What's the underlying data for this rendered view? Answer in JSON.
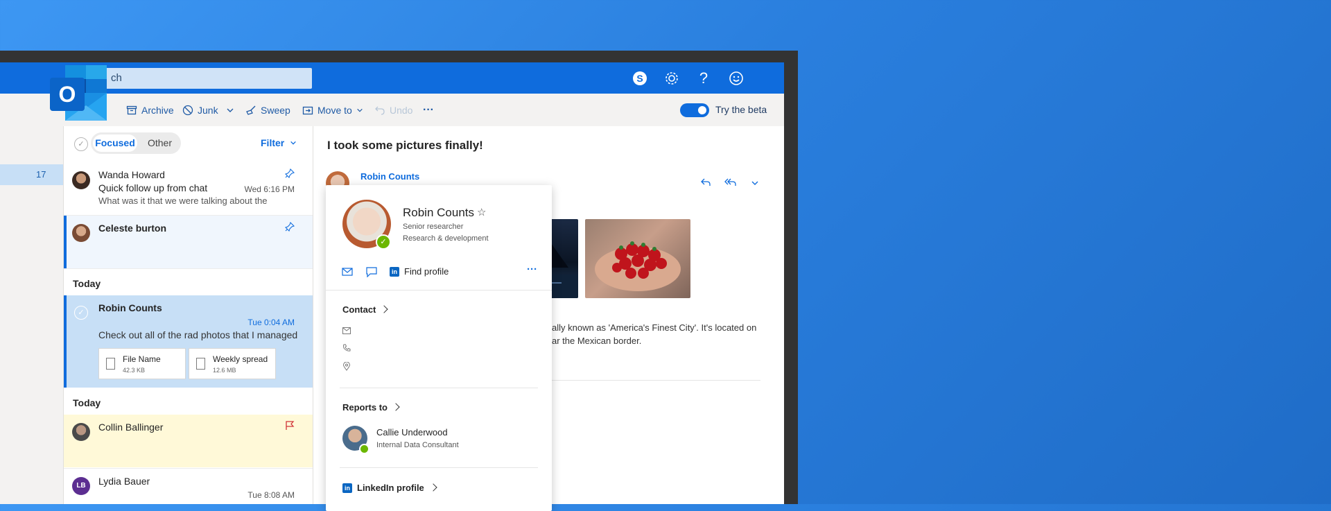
{
  "colors": {
    "brand": "#0f6cdd",
    "background": "#2a7fde",
    "selected": "#c7dff6",
    "flagged": "#fff9d8"
  },
  "app": {
    "logo_letter": "O",
    "search_text": "ch"
  },
  "topbar": {
    "icons": [
      "skype-icon",
      "settings-gear-icon",
      "help-icon",
      "feedback-smiley-icon"
    ]
  },
  "toolbar": {
    "archive": "Archive",
    "junk": "Junk",
    "sweep": "Sweep",
    "move_to": "Move to",
    "undo": "Undo",
    "more": "···",
    "try_beta": "Try the beta"
  },
  "left_pane": {
    "selected_number": "17"
  },
  "list": {
    "pivots": {
      "focused": "Focused",
      "other": "Other"
    },
    "filter": "Filter",
    "groups": [
      "Today",
      "Today"
    ],
    "items": [
      {
        "sender": "Wanda Howard",
        "subject": "Quick follow up from chat",
        "time": "Wed 6:16 PM",
        "preview": "What was it that we were talking about the"
      },
      {
        "sender": "Celeste burton"
      },
      {
        "sender": "Robin Counts",
        "time": "Tue 0:04 AM",
        "preview": "Check out all of the rad photos that I managed",
        "attachments": [
          {
            "name": "File Name",
            "size": "42.3 KB"
          },
          {
            "name": "Weekly spread",
            "size": "12.6 MB"
          }
        ]
      },
      {
        "sender": "Collin Ballinger"
      },
      {
        "sender": "Lydia Bauer",
        "initials": "LB",
        "time": "Tue 8:08 AM"
      }
    ]
  },
  "reading": {
    "subject": "I took some pictures finally!",
    "from": "Robin Counts",
    "body_line1": "ally known as 'America's Finest City'. It's located on",
    "body_line2": "ar the Mexican border."
  },
  "contact_card": {
    "name": "Robin Counts",
    "star": "☆",
    "title": "Senior researcher",
    "department": "Research & development",
    "find_profile": "Find profile",
    "more": "···",
    "contact_heading": "Contact",
    "reports_to_heading": "Reports to",
    "manager": {
      "name": "Callie Underwood",
      "title": "Internal Data Consultant"
    },
    "linkedin": "LinkedIn profile",
    "linkedin_badge": "in"
  }
}
